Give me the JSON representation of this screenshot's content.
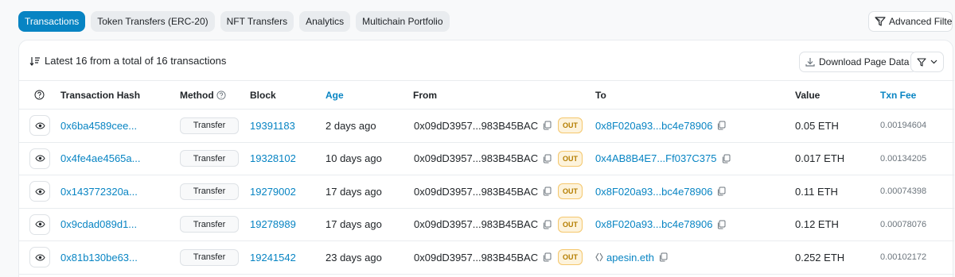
{
  "tabs": [
    {
      "label": "Transactions",
      "active": true
    },
    {
      "label": "Token Transfers (ERC-20)"
    },
    {
      "label": "NFT Transfers"
    },
    {
      "label": "Analytics"
    },
    {
      "label": "Multichain Portfolio"
    }
  ],
  "advanced_filter_label": "Advanced Filter",
  "summary": "Latest 16 from a total of 16 transactions",
  "download_label": "Download Page Data",
  "columns": {
    "hash": "Transaction Hash",
    "method": "Method",
    "block": "Block",
    "age": "Age",
    "from": "From",
    "to": "To",
    "value": "Value",
    "fee": "Txn Fee"
  },
  "rows": [
    {
      "hash": "0x6ba4589cee...",
      "method": "Transfer",
      "block": "19391183",
      "age": "2 days ago",
      "from": "0x09dD3957...983B45BAC",
      "direction": "OUT",
      "to": "0x8F020a93...bc4e78906",
      "value": "0.05 ETH",
      "fee": "0.00194604"
    },
    {
      "hash": "0x4fe4ae4565a...",
      "method": "Transfer",
      "block": "19328102",
      "age": "10 days ago",
      "from": "0x09dD3957...983B45BAC",
      "direction": "OUT",
      "to": "0x4AB8B4E7...Ff037C375",
      "value": "0.017 ETH",
      "fee": "0.00134205"
    },
    {
      "hash": "0x143772320a...",
      "method": "Transfer",
      "block": "19279002",
      "age": "17 days ago",
      "from": "0x09dD3957...983B45BAC",
      "direction": "OUT",
      "to": "0x8F020a93...bc4e78906",
      "value": "0.11 ETH",
      "fee": "0.00074398"
    },
    {
      "hash": "0x9cdad089d1...",
      "method": "Transfer",
      "block": "19278989",
      "age": "17 days ago",
      "from": "0x09dD3957...983B45BAC",
      "direction": "OUT",
      "to": "0x8F020a93...bc4e78906",
      "value": "0.12 ETH",
      "fee": "0.00078076"
    },
    {
      "hash": "0x81b130be63...",
      "method": "Transfer",
      "block": "19241542",
      "age": "23 days ago",
      "from": "0x09dD3957...983B45BAC",
      "direction": "OUT",
      "to": "apesin.eth",
      "to_is_ens": true,
      "value": "0.252 ETH",
      "fee": "0.00102172"
    }
  ],
  "colors": {
    "accent": "#0784c3",
    "out_badge_bg": "#fdf3dc",
    "out_badge_text": "#b47d00"
  }
}
